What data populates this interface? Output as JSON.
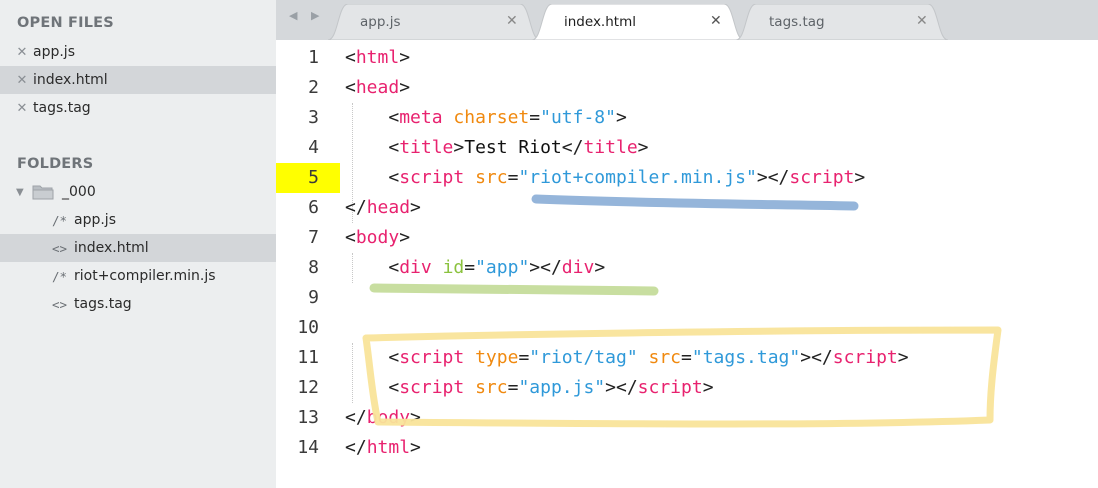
{
  "sidebar": {
    "open_files_heading": "OPEN FILES",
    "open_files": [
      {
        "close_glyph": "✕",
        "label": "app.js",
        "selected": false
      },
      {
        "close_glyph": "✕",
        "label": "index.html",
        "selected": true
      },
      {
        "close_glyph": "✕",
        "label": "tags.tag",
        "selected": false
      }
    ],
    "folders_heading": "FOLDERS",
    "folder": {
      "arrow": "▼",
      "icon": "folder-icon",
      "label": "_000"
    },
    "files": [
      {
        "glyph": "/*",
        "label": "app.js",
        "selected": false
      },
      {
        "glyph": "<>",
        "label": "index.html",
        "selected": true
      },
      {
        "glyph": "/*",
        "label": "riot+compiler.min.js",
        "selected": false
      },
      {
        "glyph": "<>",
        "label": "tags.tag",
        "selected": false
      }
    ]
  },
  "tabs": {
    "nav_arrows": "◀ ▶",
    "items": [
      {
        "label": "app.js",
        "close": "✕",
        "active": false
      },
      {
        "label": "index.html",
        "close": "✕",
        "active": true
      },
      {
        "label": "tags.tag",
        "close": "✕",
        "active": false
      }
    ]
  },
  "editor": {
    "highlighted_line": 5,
    "lines": [
      {
        "n": "1",
        "tokens": [
          [
            "p",
            "<"
          ],
          [
            "t",
            "html"
          ],
          [
            "p",
            ">"
          ]
        ]
      },
      {
        "n": "2",
        "tokens": [
          [
            "p",
            "<"
          ],
          [
            "t",
            "head"
          ],
          [
            "p",
            ">"
          ]
        ]
      },
      {
        "n": "3",
        "tokens": [
          [
            "x",
            "    "
          ],
          [
            "p",
            "<"
          ],
          [
            "t",
            "meta"
          ],
          [
            "x",
            " "
          ],
          [
            "a",
            "charset"
          ],
          [
            "p",
            "="
          ],
          [
            "v",
            "\"utf-8\""
          ],
          [
            "p",
            ">"
          ]
        ]
      },
      {
        "n": "4",
        "tokens": [
          [
            "x",
            "    "
          ],
          [
            "p",
            "<"
          ],
          [
            "t",
            "title"
          ],
          [
            "p",
            ">"
          ],
          [
            "x",
            "Test Riot"
          ],
          [
            "p",
            "</"
          ],
          [
            "t",
            "title"
          ],
          [
            "p",
            ">"
          ]
        ]
      },
      {
        "n": "5",
        "tokens": [
          [
            "x",
            "    "
          ],
          [
            "p",
            "<"
          ],
          [
            "t",
            "script"
          ],
          [
            "x",
            " "
          ],
          [
            "a",
            "src"
          ],
          [
            "p",
            "="
          ],
          [
            "v",
            "\"riot+compiler.min.js\""
          ],
          [
            "p",
            "></"
          ],
          [
            "t",
            "script"
          ],
          [
            "p",
            ">"
          ]
        ]
      },
      {
        "n": "6",
        "tokens": [
          [
            "p",
            "</"
          ],
          [
            "t",
            "head"
          ],
          [
            "p",
            ">"
          ]
        ]
      },
      {
        "n": "7",
        "tokens": [
          [
            "p",
            "<"
          ],
          [
            "t",
            "body"
          ],
          [
            "p",
            ">"
          ]
        ]
      },
      {
        "n": "8",
        "tokens": [
          [
            "x",
            "    "
          ],
          [
            "p",
            "<"
          ],
          [
            "t",
            "div"
          ],
          [
            "x",
            " "
          ],
          [
            "aid",
            "id"
          ],
          [
            "p",
            "="
          ],
          [
            "v",
            "\"app\""
          ],
          [
            "p",
            "></"
          ],
          [
            "t",
            "div"
          ],
          [
            "p",
            ">"
          ]
        ]
      },
      {
        "n": "9",
        "tokens": []
      },
      {
        "n": "10",
        "tokens": []
      },
      {
        "n": "11",
        "tokens": [
          [
            "x",
            "    "
          ],
          [
            "p",
            "<"
          ],
          [
            "t",
            "script"
          ],
          [
            "x",
            " "
          ],
          [
            "a",
            "type"
          ],
          [
            "p",
            "="
          ],
          [
            "v",
            "\"riot/tag\""
          ],
          [
            "x",
            " "
          ],
          [
            "a",
            "src"
          ],
          [
            "p",
            "="
          ],
          [
            "v",
            "\"tags.tag\""
          ],
          [
            "p",
            "></"
          ],
          [
            "t",
            "script"
          ],
          [
            "p",
            ">"
          ]
        ]
      },
      {
        "n": "12",
        "tokens": [
          [
            "x",
            "    "
          ],
          [
            "p",
            "<"
          ],
          [
            "t",
            "script"
          ],
          [
            "x",
            " "
          ],
          [
            "a",
            "src"
          ],
          [
            "p",
            "="
          ],
          [
            "v",
            "\"app.js\""
          ],
          [
            "p",
            "></"
          ],
          [
            "t",
            "script"
          ],
          [
            "p",
            ">"
          ]
        ]
      },
      {
        "n": "13",
        "tokens": [
          [
            "p",
            "</"
          ],
          [
            "t",
            "body"
          ],
          [
            "p",
            ">"
          ]
        ]
      },
      {
        "n": "14",
        "tokens": [
          [
            "p",
            "</"
          ],
          [
            "t",
            "html"
          ],
          [
            "p",
            ">"
          ]
        ]
      }
    ]
  },
  "annotations": {
    "colors": {
      "blue_underline": "#8fb1d8",
      "green_underline": "#c5dc9b",
      "yellow_box": "#f9e49a",
      "line_highlight": "#ffff00"
    }
  }
}
